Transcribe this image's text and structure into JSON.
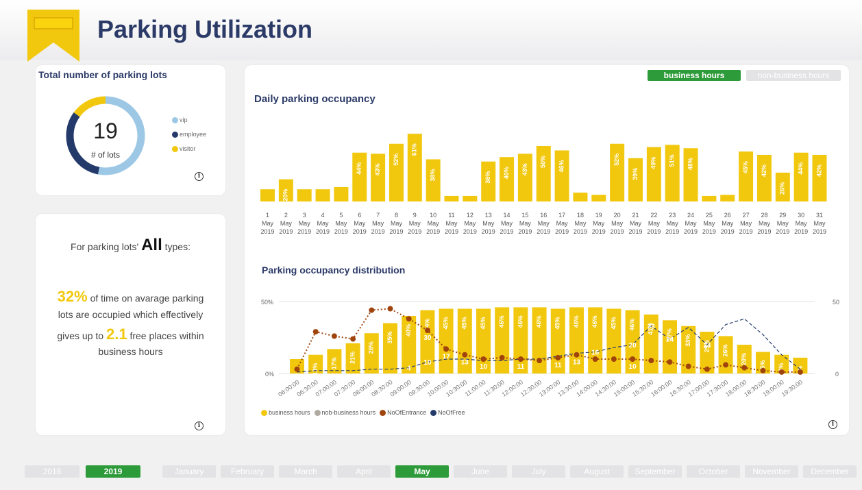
{
  "title": "Parking Utilization",
  "lots": {
    "title": "Total number of parking lots",
    "value": "19",
    "unit": "# of lots",
    "legend": [
      {
        "label": "vip",
        "color": "#9cc8e6"
      },
      {
        "label": "employee",
        "color": "#233a6b"
      },
      {
        "label": "visitor",
        "color": "#f2c80f"
      }
    ],
    "shares": {
      "vip": 0.53,
      "employee": 0.32,
      "visitor": 0.15
    }
  },
  "summary": {
    "line1_prefix": "For parking lots'",
    "line1_type": "All",
    "line1_suffix": "types:",
    "pct": "32%",
    "text_a": "of time on avarage parking",
    "text_b": "lots are occupied which effectively",
    "gives": "gives up to",
    "places": "2.1",
    "text_c": "free places within",
    "text_d": "business hours"
  },
  "toggle": {
    "business": "business hours",
    "nonbusiness": "non-business hours"
  },
  "daily_title": "Daily parking occupancy",
  "dist_title": "Parking occupancy distribution",
  "legend2": [
    {
      "label": "business hours",
      "color": "#f2c80f"
    },
    {
      "label": "nob-business hours",
      "color": "#b0aaa0"
    },
    {
      "label": "NoOfEntrance",
      "color": "#a0440d"
    },
    {
      "label": "NoOfFree",
      "color": "#233a6b"
    }
  ],
  "years": [
    "2018",
    "2019"
  ],
  "selected_year": "2019",
  "months": [
    "January",
    "February",
    "March",
    "April",
    "May",
    "June",
    "July",
    "August",
    "September",
    "October",
    "November",
    "December"
  ],
  "selected_month": "May",
  "chart_data": [
    {
      "type": "bar",
      "title": "Daily parking occupancy",
      "categories": [
        "1",
        "2",
        "3",
        "4",
        "5",
        "6",
        "7",
        "8",
        "9",
        "10",
        "11",
        "12",
        "13",
        "14",
        "15",
        "16",
        "17",
        "18",
        "19",
        "20",
        "21",
        "22",
        "23",
        "24",
        "25",
        "26",
        "27",
        "28",
        "29",
        "30",
        "31"
      ],
      "month_label": "May",
      "year_label": "2019",
      "values": [
        11,
        20,
        11,
        11,
        13,
        44,
        43,
        52,
        61,
        38,
        5,
        5,
        36,
        40,
        43,
        50,
        46,
        8,
        6,
        52,
        39,
        49,
        51,
        48,
        5,
        6,
        45,
        42,
        26,
        44,
        42
      ],
      "labels": [
        "",
        "20%",
        "",
        "",
        "",
        "44%",
        "43%",
        "52%",
        "61%",
        "38%",
        "",
        "",
        "36%",
        "40%",
        "43%",
        "50%",
        "46%",
        "",
        "",
        "52%",
        "39%",
        "49%",
        "51%",
        "48%",
        "",
        "",
        "45%",
        "42%",
        "26%",
        "44%",
        "42%"
      ],
      "color": "#f2c80f"
    },
    {
      "type": "bar+line",
      "title": "Parking occupancy distribution",
      "categories": [
        "06:00:00",
        "06:30:00",
        "07:00:00",
        "07:30:00",
        "08:00:00",
        "08:30:00",
        "09:00:00",
        "09:30:00",
        "10:00:00",
        "10:30:00",
        "11:00:00",
        "11:30:00",
        "12:00:00",
        "12:30:00",
        "13:00:00",
        "13:30:00",
        "14:00:00",
        "14:30:00",
        "15:00:00",
        "15:30:00",
        "16:00:00",
        "16:30:00",
        "17:00:00",
        "17:30:00",
        "18:00:00",
        "18:30:00",
        "19:00:00",
        "19:30:00"
      ],
      "y_ticks_left": [
        "50%",
        "0%"
      ],
      "y_ticks_right": [
        "50",
        "0"
      ],
      "bars": {
        "name": "business hours",
        "values": [
          10,
          13,
          17,
          21,
          28,
          35,
          40,
          44,
          45,
          45,
          45,
          46,
          46,
          46,
          45,
          46,
          46,
          45,
          44,
          41,
          37,
          33,
          29,
          26,
          20,
          15,
          13,
          11
        ],
        "labels": [
          "",
          "13%",
          "17%",
          "21%",
          "28%",
          "35%",
          "40%",
          "44%",
          "45%",
          "45%",
          "45%",
          "46%",
          "46%",
          "46%",
          "45%",
          "46%",
          "46%",
          "45%",
          "46%",
          "41%",
          "37%",
          "33%",
          "29%",
          "26%",
          "20%",
          "15%",
          "13%",
          "11%"
        ]
      },
      "entrance": {
        "name": "NoOfEntrance",
        "values": [
          3,
          29,
          26,
          24,
          44,
          45,
          38,
          30,
          17,
          13,
          10,
          11,
          10,
          9,
          11,
          13,
          10,
          10,
          10,
          9,
          8,
          5,
          3,
          6,
          4,
          2,
          1,
          1
        ],
        "labels": [
          "",
          "",
          "",
          "",
          "",
          "",
          "",
          "30",
          "17",
          "13",
          "10",
          "",
          "11",
          "",
          "11",
          "13",
          "",
          "",
          "10",
          "",
          "",
          "",
          "",
          "",
          "",
          "",
          "",
          ""
        ]
      },
      "free": {
        "name": "NoOfFree",
        "values": [
          1,
          2,
          2,
          2,
          3,
          3,
          4,
          8,
          10,
          10,
          9,
          9,
          10,
          10,
          12,
          14,
          15,
          18,
          20,
          33,
          24,
          32,
          20,
          34,
          38,
          27,
          13,
          3
        ],
        "labels": [
          "",
          "",
          "",
          "",
          "",
          "",
          "4",
          "10",
          "",
          "",
          "",
          "",
          "",
          "",
          "",
          "",
          "16",
          "",
          "20",
          "33",
          "24",
          "",
          "24",
          "",
          "",
          "",
          "",
          ""
        ]
      },
      "ylim": [
        0,
        50
      ]
    }
  ]
}
